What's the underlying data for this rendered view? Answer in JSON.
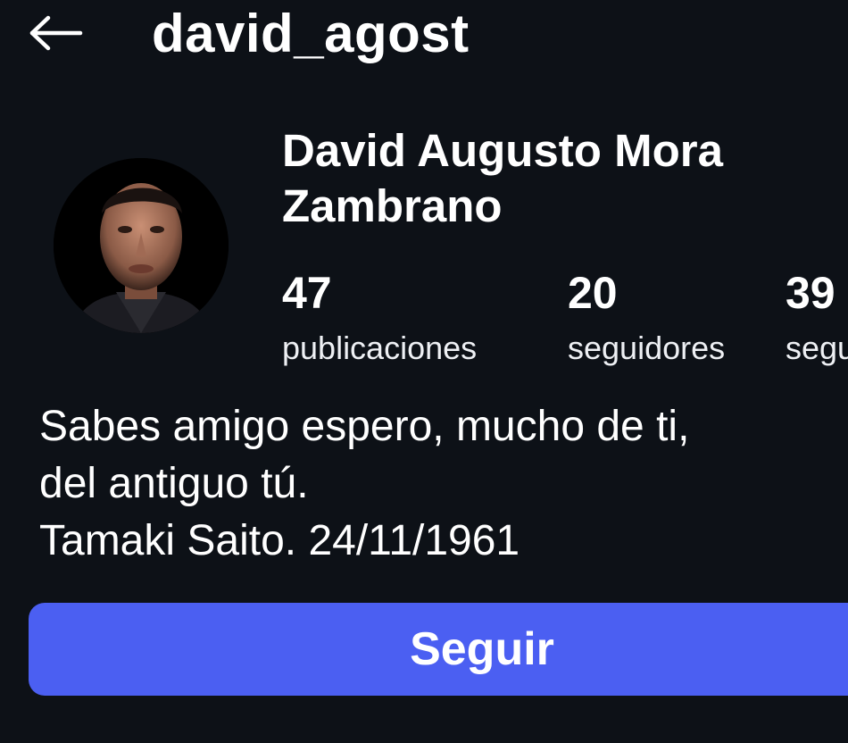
{
  "header": {
    "back_icon": "arrow-left-icon",
    "username": "david_agost"
  },
  "profile": {
    "avatar": "profile-photo",
    "full_name": "David Augusto Mora Zambrano"
  },
  "stats": {
    "posts": {
      "count": "47",
      "label": "publicaciones"
    },
    "followers": {
      "count": "20",
      "label": "seguidores"
    },
    "following": {
      "count": "39",
      "label": "seguidos"
    }
  },
  "bio": {
    "line1": "Sabes amigo espero, mucho de ti,",
    "line2": "del antiguo tú.",
    "line3": "Tamaki Saito. 24/11/1961"
  },
  "actions": {
    "follow_label": "Seguir",
    "follow_color": "#4b5ff2"
  },
  "colors": {
    "background": "#0d1117",
    "text": "#ffffff"
  }
}
